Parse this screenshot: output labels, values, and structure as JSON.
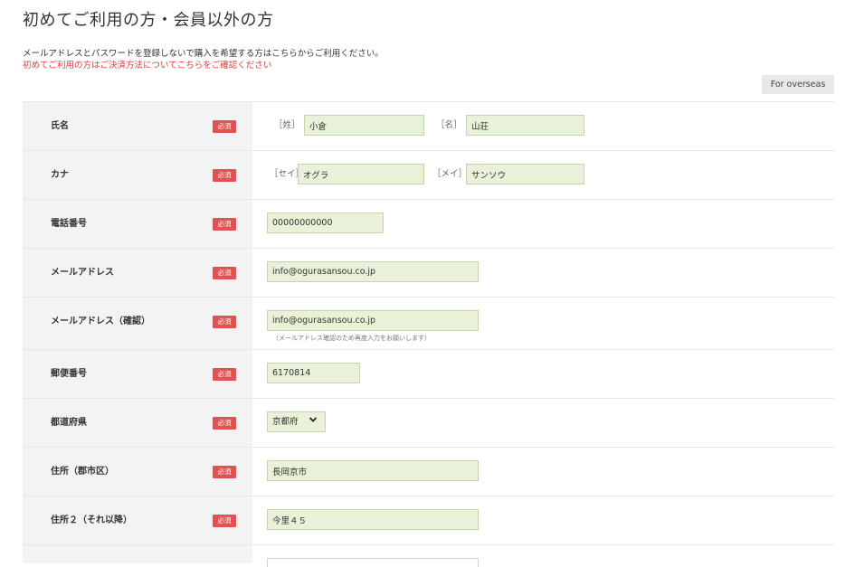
{
  "page": {
    "title": "初めてご利用の方・会員以外の方",
    "notice_line1": "メールアドレスとパスワードを登録しないで購入を希望する方はこちらからご利用ください。",
    "notice_line2": "初めてご利用の方はご決済方法についてこちらをご確認ください",
    "overseas_button": "For overseas"
  },
  "form": {
    "required_badge": "必須",
    "name": {
      "label": "氏名",
      "last_prefix": "［姓］",
      "last_value": "小倉",
      "first_prefix": "［名］",
      "first_value": "山荘"
    },
    "kana": {
      "label": "カナ",
      "last_prefix": "［セイ］",
      "last_value": "オグラ",
      "first_prefix": "［メイ］",
      "first_value": "サンソウ"
    },
    "phone": {
      "label": "電話番号",
      "value": "00000000000"
    },
    "email": {
      "label": "メールアドレス",
      "value": "info@ogurasansou.co.jp"
    },
    "email_confirm": {
      "label": "メールアドレス（確認）",
      "value": "info@ogurasansou.co.jp",
      "hint": "（メールアドレス確認のため再度入力をお願いします）"
    },
    "postal": {
      "label": "郵便番号",
      "value": "6170814"
    },
    "prefecture": {
      "label": "都道府県",
      "value": "京都府"
    },
    "address1": {
      "label": "住所（郡市区）",
      "value": "長岡京市"
    },
    "address2": {
      "label": "住所２（それ以降）",
      "value": "今里４５"
    }
  },
  "icons": {
    "select_arrow": "chevron-down-icon"
  },
  "colors": {
    "required": "#e25252",
    "input_bg": "#e9f1d9",
    "label_bg": "#f3f3f3",
    "notice_red": "#e33a3a"
  }
}
